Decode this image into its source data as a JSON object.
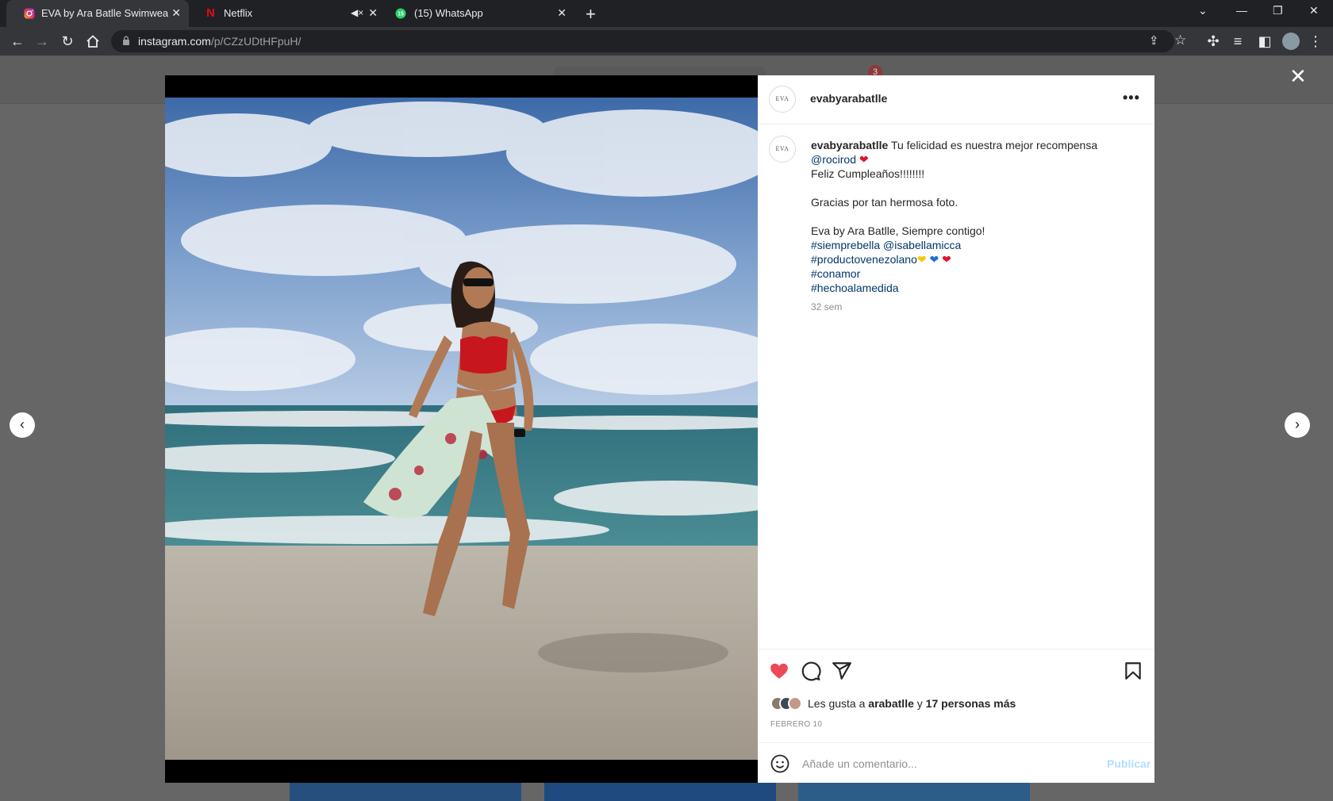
{
  "browser": {
    "tabs": [
      {
        "title": "EVA by Ara Batlle Swimwear (@",
        "active": true,
        "icon": "instagram-icon"
      },
      {
        "title": "Netflix",
        "active": false,
        "icon": "netflix-icon",
        "muted": true
      },
      {
        "title": "(15) WhatsApp",
        "active": false,
        "icon": "whatsapp-icon",
        "badge": "15"
      }
    ],
    "url_host": "instagram.com",
    "url_path": "/p/CZzUDtHFpuH/",
    "notification_count": "3"
  },
  "post": {
    "username": "evabyarabatlle",
    "avatar_text": "EVA",
    "caption_lines": [
      "Tu felicidad es nuestra mejor recompensa",
      "@rocirod",
      "Feliz Cumpleaños!!!!!!!!",
      "",
      "Gracias por tan hermosa foto.",
      "",
      "Eva by Ara Batlle, Siempre contigo!",
      "#siemprebella @isabellamicca",
      "#productovenezolano",
      "#conamor",
      "#hechoalamedida"
    ],
    "emoji_heart": "❤",
    "emoji_yellow_heart": "❤",
    "emoji_blue_heart": "❤",
    "time_ago": "32 sem",
    "likes_prefix": "Les gusta a",
    "likes_user": "arabatlle",
    "likes_and": "y",
    "likes_others": "17 personas más",
    "date": "FEBRERO 10",
    "liked": true,
    "comment_placeholder": "Añade un comentario...",
    "publish_label": "Publicar"
  },
  "colors": {
    "like_red": "#ed4956",
    "link_blue": "#00376b",
    "publish_blue": "#b2dffc"
  }
}
